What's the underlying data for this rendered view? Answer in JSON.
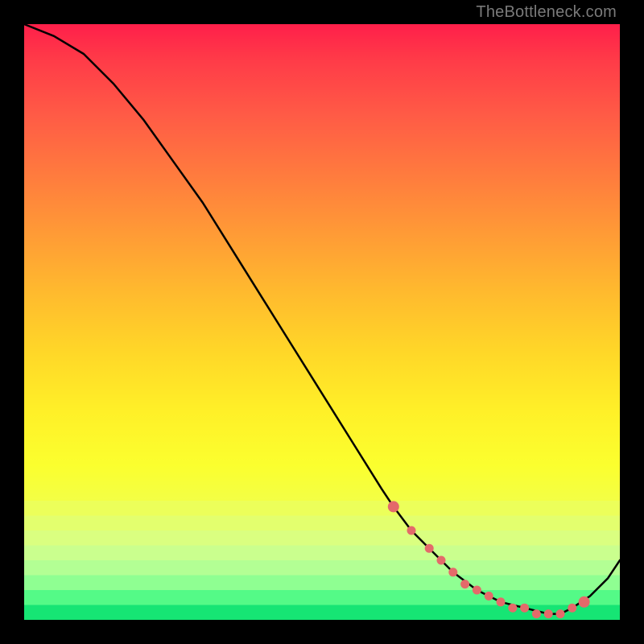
{
  "watermark": "TheBottleneck.com",
  "chart_data": {
    "type": "line",
    "title": "",
    "xlabel": "",
    "ylabel": "",
    "xlim": [
      0,
      100
    ],
    "ylim": [
      0,
      100
    ],
    "grid": false,
    "legend": false,
    "series": [
      {
        "name": "bottleneck-curve",
        "color": "#000000",
        "x": [
          0,
          5,
          10,
          15,
          20,
          25,
          30,
          35,
          40,
          45,
          50,
          55,
          60,
          62,
          65,
          68,
          72,
          76,
          80,
          84,
          88,
          90,
          92,
          95,
          98,
          100
        ],
        "y": [
          100,
          98,
          95,
          90,
          84,
          77,
          70,
          62,
          54,
          46,
          38,
          30,
          22,
          19,
          15,
          12,
          8,
          5,
          3,
          2,
          1,
          1,
          2,
          4,
          7,
          10
        ]
      }
    ],
    "highlight_points": {
      "name": "trough-dots",
      "color": "#e46a6a",
      "x": [
        62,
        65,
        68,
        70,
        72,
        74,
        76,
        78,
        80,
        82,
        84,
        86,
        88,
        90,
        92,
        94
      ],
      "y": [
        19,
        15,
        12,
        10,
        8,
        6,
        5,
        4,
        3,
        2,
        2,
        1,
        1,
        1,
        2,
        3
      ]
    }
  }
}
